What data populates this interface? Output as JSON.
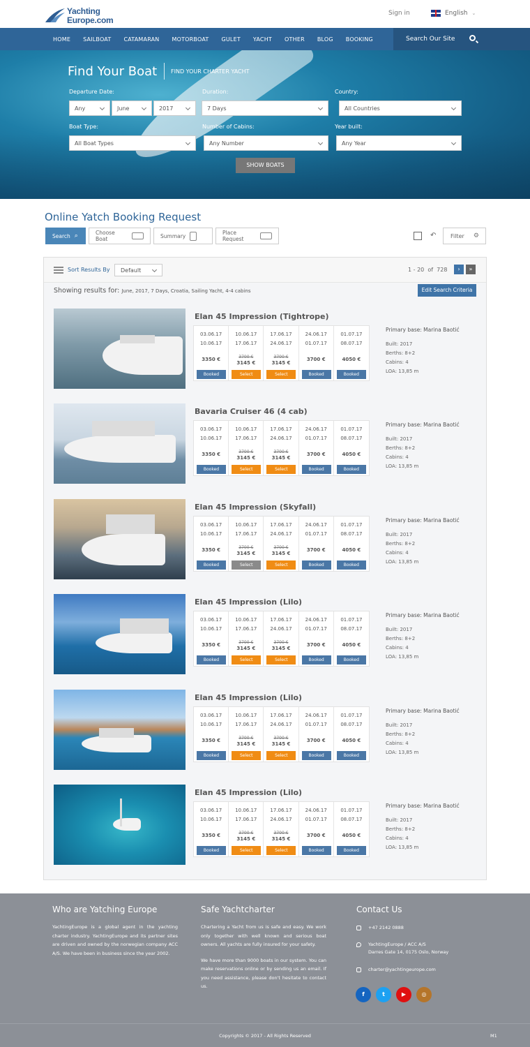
{
  "logo": {
    "line1": "Yachting",
    "line2": "Europe.com"
  },
  "topbar": {
    "signin": "Sign in",
    "language": "English"
  },
  "nav": {
    "items": [
      "HOME",
      "SAILBOAT",
      "CATAMARAN",
      "MOTORBOAT",
      "GULET",
      "YACHT",
      "OTHER",
      "BLOG",
      "BOOKING"
    ],
    "search": "Search Our Site"
  },
  "hero": {
    "title": "Find Your Boat",
    "subtitle": "FIND YOUR CHARTER YACHT",
    "departure_label": "Departure Date:",
    "day": "Any",
    "month": "June",
    "year": "2017",
    "duration_label": "Duration:",
    "duration": "7 Days",
    "country_label": "Country:",
    "country": "All Countries",
    "boattype_label": "Boat Type:",
    "boattype": "All Boat Types",
    "cabins_label": "Number of Cabins:",
    "cabins": "Any Number",
    "yearbuilt_label": "Year built:",
    "yearbuilt": "Any Year",
    "show_button": "SHOW BOATS"
  },
  "page_title": "Online Yatch Booking Request",
  "steps": [
    "Search",
    "Choose Boat",
    "Summary",
    "Place Request"
  ],
  "filter": "Filter",
  "results": {
    "sort_label": "Sort Results By",
    "sort_value": "Default",
    "page_from": "1",
    "page_dash": "-",
    "page_to": "20",
    "page_of": "of",
    "page_total": "728",
    "showing_label": "Showing results for:",
    "showing_value": "June, 2017, 7 Days, Croatia, Sailing Yacht, 4-4 cabins",
    "edit_button": "Edit Search Criteria"
  },
  "periods": [
    {
      "from": "03.06.17",
      "to": "10.06.17",
      "old": "",
      "price": "3350 €",
      "status": "Booked"
    },
    {
      "from": "10.06.17",
      "to": "17.06.17",
      "old": "3700 €",
      "price": "3145 €",
      "status": "Select"
    },
    {
      "from": "17.06.17",
      "to": "24.06.17",
      "old": "3700 €",
      "price": "3145 €",
      "status": "Select"
    },
    {
      "from": "24.06.17",
      "to": "01.07.17",
      "old": "",
      "price": "3700 €",
      "status": "Booked"
    },
    {
      "from": "01.07.17",
      "to": "08.07.17",
      "old": "",
      "price": "4050 €",
      "status": "Booked"
    }
  ],
  "boats": [
    {
      "name": "Elan 45 Impression (Tightrope)",
      "base": "Primary base: Marina Baotić",
      "built": "Built: 2017",
      "berths": "Berths: 8+2",
      "cabins": "Cabins: 4",
      "loa": "LOA: 13,85 m"
    },
    {
      "name": "Bavaria Cruiser 46 (4 cab)",
      "base": "Primary base: Marina Baotić",
      "built": "Built: 2017",
      "berths": "Berths: 8+2",
      "cabins": "Cabins: 4",
      "loa": "LOA: 13,85 m"
    },
    {
      "name": "Elan 45 Impression (Skyfall)",
      "base": "Primary base: Marina Baotić",
      "built": "Built: 2017",
      "berths": "Berths: 8+2",
      "cabins": "Cabins: 4",
      "loa": "LOA: 13,85 m"
    },
    {
      "name": "Elan 45 Impression (Lilo)",
      "base": "Primary base: Marina Baotić",
      "built": "Built: 2017",
      "berths": "Berths: 8+2",
      "cabins": "Cabins: 4",
      "loa": "LOA: 13,85 m"
    },
    {
      "name": "Elan 45 Impression (Lilo)",
      "base": "Primary base: Marina Baotić",
      "built": "Built: 2017",
      "berths": "Berths: 8+2",
      "cabins": "Cabins: 4",
      "loa": "LOA: 13,85 m"
    },
    {
      "name": "Elan 45 Impression (Lilo)",
      "base": "Primary base: Marina Baotić",
      "built": "Built: 2017",
      "berths": "Berths: 8+2",
      "cabins": "Cabins: 4",
      "loa": "LOA: 13,85 m"
    }
  ],
  "footer": {
    "about_title": "Who are Yatching Europe",
    "about_text": "YachtingEurope is a global agent in the yachting charter industry. YachtingEurope and its partner sites are driven and owned by the norwegian company ACC A/S. We have been in business since the year 2002.",
    "safe_title": "Safe Yachtcharter",
    "safe_text1": "Chartering a Yacht from us is safe and easy. We work only together with well known and serious boat owners. All yachts are fully insured for your safety.",
    "safe_text2": "We have more than 9000 boats in our system. You can make reservations online or by sending us an email. If you need assistance, please don't hesitate to contact us.",
    "contact_title": "Contact Us",
    "phone": "+47 2142 0888",
    "address1": "YachtingEurope / ACC A/S",
    "address2": "Darres Gate 14, 0175 Oslo, Norway",
    "email": "charter@yachtingeurope.com",
    "social": [
      "f",
      "t",
      "▶",
      "◎"
    ],
    "copyright": "Copyrights © 2017 - All Rights Reserved",
    "code": "M1"
  },
  "colors": {
    "primary": "#2f6598",
    "select": "#f08c14",
    "booked": "#4a77a6",
    "footer": "#8c9097"
  }
}
